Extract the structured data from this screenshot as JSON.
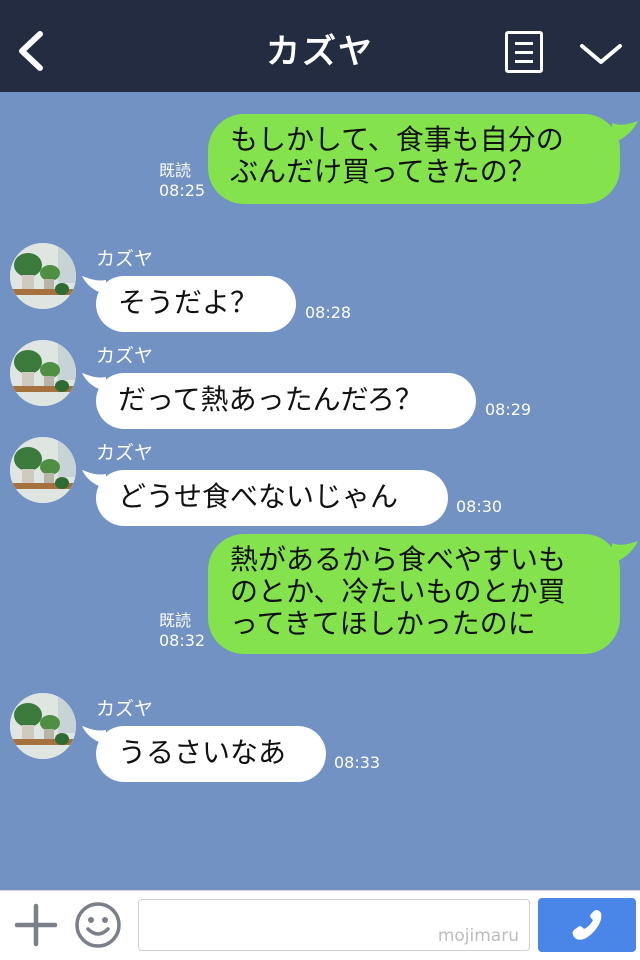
{
  "header": {
    "title": "カズヤ",
    "back_icon": "chevron-left-icon",
    "menu_icon": "document-list-icon",
    "collapse_icon": "chevron-down-icon"
  },
  "messages": [
    {
      "direction": "sent",
      "text": "もしかして、食事も自分の\nぶんだけ買ってきたの？",
      "read_label": "既読",
      "time": "08:25"
    },
    {
      "direction": "received",
      "sender": "カズヤ",
      "text": "そうだよ？",
      "time": "08:28"
    },
    {
      "direction": "received",
      "sender": "カズヤ",
      "text": "だって熱あったんだろ？",
      "time": "08:29"
    },
    {
      "direction": "received",
      "sender": "カズヤ",
      "text": "どうせ食べないじゃん",
      "time": "08:30"
    },
    {
      "direction": "sent",
      "text": "熱があるから食べやすいも\nのとか、冷たいものとか買\nってきてほしかったのに",
      "read_label": "既読",
      "time": "08:32"
    },
    {
      "direction": "received",
      "sender": "カズヤ",
      "text": "うるさいなあ",
      "time": "08:33"
    }
  ],
  "input_bar": {
    "add_icon": "plus-icon",
    "emoji_icon": "smiley-icon",
    "watermark": "mojimaru",
    "call_icon": "phone-icon"
  },
  "colors": {
    "header_bg": "#232c41",
    "chat_bg": "#7292c3",
    "sent_bubble": "#84e24c",
    "received_bubble": "#ffffff",
    "call_button": "#4a86e8"
  }
}
